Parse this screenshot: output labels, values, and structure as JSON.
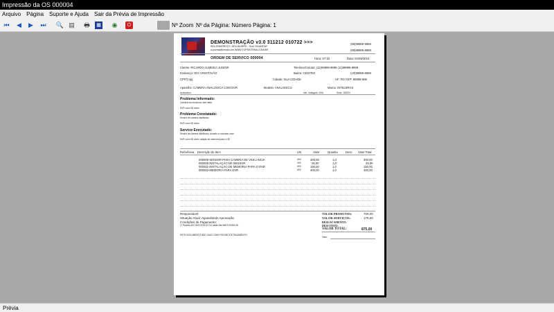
{
  "window": {
    "title": "Impressão da OS 000004"
  },
  "menu": [
    "Arquivo",
    "Página",
    "Suporte e Ajuda",
    "Sair da Prévia de Impressão"
  ],
  "toolbar": {
    "zoom_label": "Nº Zoom",
    "page_label": "Nº da Página: Número Página: 1"
  },
  "status": {
    "text": "Prévia"
  },
  "doc": {
    "company": "DEMONSTRAÇÃO v3.0 311212 010722 >>>",
    "address": "SEU ENDEREÇO / SEU BAIRRO - SUA CIDADE/UF",
    "email_site": "a.jourmal@email.com   WWW.TOPSISTEMA.COM.BR",
    "phone1": "(99)99999-9999",
    "phone2": "(88)88888-8888",
    "hora": "Hora: 07:18",
    "data": "Data: 02/09/2023",
    "os_title": "ORDEM DE SERVICO 000004",
    "cliente": "Cliente: RICARDO ALMEIDA JUNIOR",
    "telefone": "Telefone/Celular: (12)99999-9999  (11)99999-9999",
    "endereco": "Endereço: RIO CRISTOVÃO",
    "bairro": "Bairro: CENTRO",
    "tel3": "(10)99999-9999",
    "cpf": "CPF/Cnpj:",
    "cidade": "Cidade: SUA CIDADE",
    "uf": "UF: RS  CEP: 88888-888",
    "aparelho": "Aparelho: CAMERA ANALOGICA COM DVR",
    "modelo": "Modelo: ANALOGICO",
    "marca": "Marca: INTELBRAS",
    "acessorios": "Acessórios :",
    "info1": "Info. Voltagem: 220v",
    "info2": "Serie: 158704",
    "prob_inf_title": "Problema Informado:",
    "prob_inf_1": "Camera nao funciona, sem ideia",
    "prob_inf_2": "DVR com HD cheio",
    "prob_con_title": "Problema Constatado:",
    "prob_con_1": "Sensor de camera danificado",
    "prob_con_2": "DVR com HD cheio",
    "serv_title": "Servico Executado:",
    "serv_1": "Sensor de camera danificado, trocado e colocado novo",
    "serv_2": "DVR com HD cheio, adição de memória para o HD",
    "cols": {
      "ref": "Referência",
      "desc": "Descrição do Item",
      "un": "UN",
      "valor": "Valor",
      "qtd": "Quantia",
      "desc2": "Desc.",
      "total": "Valor Total"
    },
    "items": [
      {
        "desc": "000009-SENSOR PARA CAMERA DE VIGILANCIA",
        "un": "UNI",
        "valor": "300,00",
        "qtd": "1,0",
        "total": "300,00"
      },
      {
        "desc": "000006-INSTALAÇÃO DE SENSOR",
        "un": "UNI",
        "valor": "25,00",
        "qtd": "1,0",
        "total": "25,00"
      },
      {
        "desc": "000001-INSTALAÇÃO DE MEMORIA PARA O DVR",
        "un": "UNI",
        "valor": "150,00",
        "qtd": "1,0",
        "total": "150,00"
      },
      {
        "desc": "000002-MEMORIA PARA DVR",
        "un": "UNI",
        "valor": "400,00",
        "qtd": "1,0",
        "total": "400,00"
      }
    ],
    "responsavel": "Responsável:",
    "situacao": "Situação Atual: Aguardando Aprovação",
    "condicoes": "Condições de Pagamento:",
    "parcela": "1ª Parcela     30/7/2023    875,00           Ol.Cartão Até 08/07/23    800,00",
    "valor_produtos_lbl": "VALOR PRODUTOS:",
    "valor_produtos": "700,00",
    "valor_servicos_lbl": "VALOR SERVIÇOS:",
    "valor_servicos": "175,00",
    "deslocamento_lbl": "DESLOCAMENTO:",
    "deslocamento": "",
    "desconto_lbl": "DESCONTO:",
    "desconto": "",
    "valor_total_lbl": "VALOR TOTAL:",
    "valor_total": "875,00",
    "footer": "ESTE DOCUMENTO NÃO VALE COMO RECIBO DE PAGAMENTO",
    "visto": "Visto:"
  }
}
